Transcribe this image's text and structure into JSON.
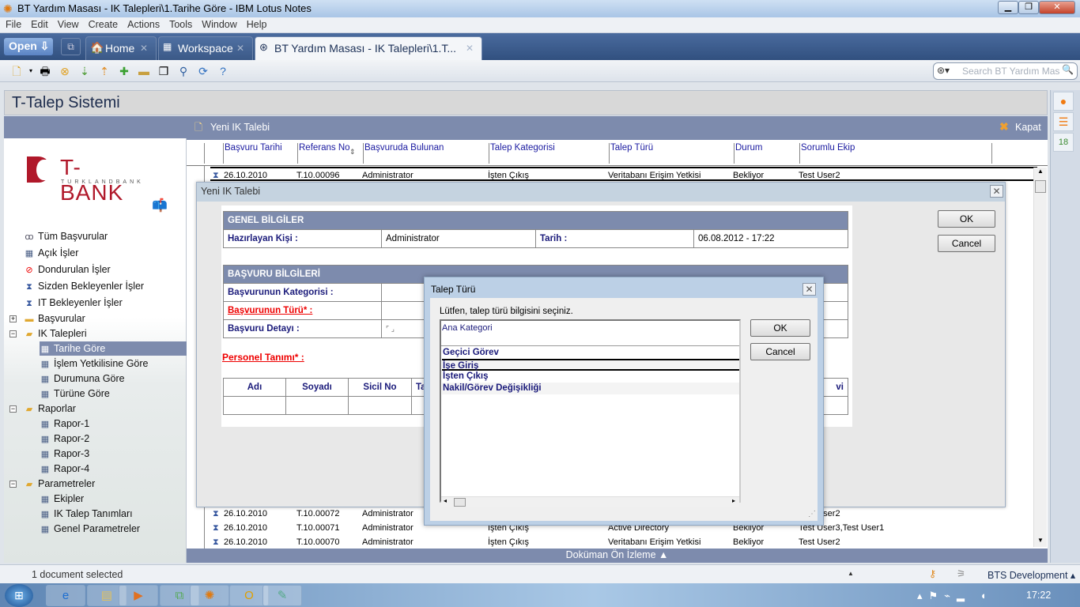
{
  "window": {
    "title": "BT Yardım Masası - IK Talepleri\\1.Tarihe Göre - IBM Lotus Notes"
  },
  "menu": [
    "File",
    "Edit",
    "View",
    "Create",
    "Actions",
    "Tools",
    "Window",
    "Help"
  ],
  "tabs": {
    "open_label": "Open",
    "items": [
      {
        "label": "Home",
        "icon": "home-icon"
      },
      {
        "label": "Workspace",
        "icon": "workspace-icon"
      },
      {
        "label": "BT Yardım Masası - IK Talepleri\\1.T...",
        "icon": "database-icon",
        "active": true
      }
    ]
  },
  "search": {
    "placeholder": "Search BT Yardım Mas"
  },
  "app": {
    "title": "T-Talep Sistemi",
    "logo": "T-BANK TURKLANDBANK"
  },
  "nav": {
    "items": [
      {
        "label": "Tüm Başvurular",
        "icon": "glasses-icon",
        "level": 0
      },
      {
        "label": "Açık İşler",
        "icon": "view-icon",
        "level": 0
      },
      {
        "label": "Dondurulan İşler",
        "icon": "no-entry-icon",
        "level": 0
      },
      {
        "label": "Sizden Bekleyenler İşler",
        "icon": "hourglass-icon",
        "level": 0
      },
      {
        "label": "IT Bekleyenler İşler",
        "icon": "hourglass-icon",
        "level": 0
      },
      {
        "label": "Başvurular",
        "icon": "folder-icon",
        "level": 0,
        "expander": "+"
      },
      {
        "label": "IK Talepleri",
        "icon": "folder-open-icon",
        "level": 0,
        "expander": "−"
      },
      {
        "label": "Tarihe Göre",
        "icon": "view-icon",
        "level": 1,
        "selected": true
      },
      {
        "label": "İşlem Yetkilisine Göre",
        "icon": "view-icon",
        "level": 1
      },
      {
        "label": "Durumuna Göre",
        "icon": "view-icon",
        "level": 1
      },
      {
        "label": "Türüne Göre",
        "icon": "view-icon",
        "level": 1
      },
      {
        "label": "Raporlar",
        "icon": "folder-open-icon",
        "level": 0,
        "expander": "−"
      },
      {
        "label": "Rapor-1",
        "icon": "view-icon",
        "level": 1
      },
      {
        "label": "Rapor-2",
        "icon": "view-icon",
        "level": 1
      },
      {
        "label": "Rapor-3",
        "icon": "view-icon",
        "level": 1
      },
      {
        "label": "Rapor-4",
        "icon": "view-icon",
        "level": 1
      },
      {
        "label": "Parametreler",
        "icon": "folder-open-icon",
        "level": 0,
        "expander": "−"
      },
      {
        "label": "Ekipler",
        "icon": "view-icon",
        "level": 1
      },
      {
        "label": "IK Talep Tanımları",
        "icon": "view-icon",
        "level": 1
      },
      {
        "label": "Genel Parametreler",
        "icon": "view-icon",
        "level": 1
      }
    ]
  },
  "actions": {
    "new": "Yeni IK Talebi",
    "close": "Kapat"
  },
  "view": {
    "columns": [
      "Başvuru Tarihi",
      "Referans No",
      "Başvuruda Bulunan",
      "Talep Kategorisi",
      "Talep Türü",
      "Durum",
      "Sorumlu Ekip"
    ],
    "rows": [
      [
        "26.10.2010",
        "T.10.00096",
        "Administrator",
        "İşten Çıkış",
        "Veritabanı Erişim Yetkisi",
        "Bekliyor",
        "Test User2"
      ],
      [
        "26.10.2010",
        "T.10.00072",
        "Administrator",
        "",
        "",
        "",
        "Test User2"
      ],
      [
        "26.10.2010",
        "T.10.00071",
        "Administrator",
        "İşten Çıkış",
        "Active Directory",
        "Bekliyor",
        "Test User3,Test User1"
      ],
      [
        "26.10.2010",
        "T.10.00070",
        "Administrator",
        "İşten Çıkış",
        "Veritabanı Erişim Yetkisi",
        "Bekliyor",
        "Test User2"
      ]
    ]
  },
  "preview": "Doküman Ön İzleme ▲",
  "dialog1": {
    "title": "Yeni IK Talebi",
    "ok": "OK",
    "cancel": "Cancel",
    "genel": {
      "header": "GENEL BİLGİLER",
      "hazirlayan_label": "Hazırlayan Kişi :",
      "hazirlayan": "Administrator",
      "tarih_label": "Tarih :",
      "tarih": "06.08.2012 - 17:22"
    },
    "basvuru": {
      "header": "BAŞVURU BİLGİLERİ",
      "kategori_label": "Başvurunun Kategorisi :",
      "tur_label": "Başvurunun Türü* :",
      "detay_label": "Başvuru Detayı :"
    },
    "personel_label": "Personel Tanımı* :",
    "personel_cols": [
      "Adı",
      "Soyadı",
      "Sicil No",
      "Ta",
      "vi"
    ]
  },
  "dialog2": {
    "title": "Talep Türü",
    "prompt": "Lütfen, talep türü bilgisini seçiniz.",
    "ok": "OK",
    "cancel": "Cancel",
    "header": "Ana Kategori",
    "options": [
      "Geçici Görev",
      "İşe Giriş",
      "İşten Çıkış",
      "Nakil/Görev Değişikliği"
    ],
    "selected": "İşe Giriş"
  },
  "status": {
    "text": "1 document selected",
    "location": "BTS Development ▴"
  },
  "taskbar": {
    "time": "17:22"
  }
}
